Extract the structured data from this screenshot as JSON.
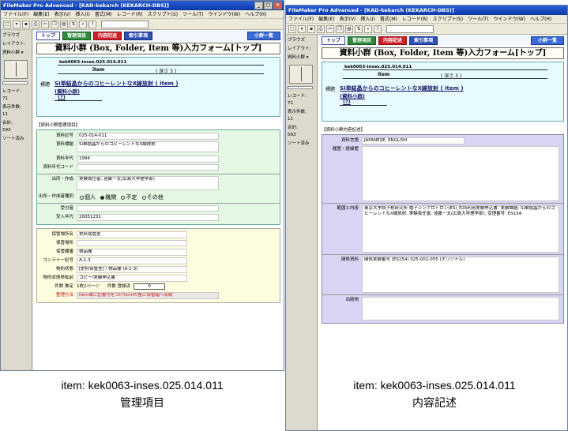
{
  "windows": [
    {
      "title": "FileMaker Pro Advanced - [KAD-kekarch (KEKARCH-DBS)]",
      "menu": [
        "ファイル(F)",
        "編集(E)",
        "表示(V)",
        "挿入(I)",
        "書式(M)",
        "レコード(R)",
        "スクリプト(S)",
        "ツール(T)",
        "ウインドウ(W)",
        "ヘルプ(H)"
      ],
      "left_panel": {
        "browse": "ブラウズ",
        "layout": "レイアウト:",
        "layout_name": "資料小群 ▾",
        "record": "レコード:",
        "record_no": "71",
        "found": "表示件数:",
        "found_no": "11",
        "total": "合計:",
        "total_no": "593",
        "sort": "ソート済み"
      },
      "nav": {
        "top": "トップ",
        "admin": "管理項目",
        "content": "内容記述",
        "index": "索引事項",
        "list": "小群一覧"
      },
      "form_title": "資料小群 (Box, Folder, Item 等)入力フォーム[トップ]",
      "item": {
        "id": "kek0063-inses.025.014.011",
        "type": "item",
        "depth": "( 深さ 3 )",
        "label": "標題",
        "title": "SI単結晶からのコヒーレントなX線放射 ( item )",
        "sub": "(資料小群)",
        "sub2": "(?)"
      },
      "section_label": "【資料小群管理項目】",
      "admin_fields": [
        {
          "label": "資料記号",
          "value": "025-014-011"
        },
        {
          "label": "資料標題",
          "value": "Si単結晶からのコヒーレントなX線放射"
        },
        {
          "label": "資料年代",
          "value": "1994"
        },
        {
          "label": "資料年代コード",
          "value": ""
        },
        {
          "label": "出所・作成",
          "value": "実験責任者: 遠藤一太(広島大学理学部)"
        }
      ],
      "origin_type": {
        "label": "出所・作成者種別",
        "options": [
          "個人",
          "機関",
          "不定",
          "その他"
        ],
        "selected": "機関"
      },
      "receipt_fields": [
        {
          "label": "受付者",
          "value": ""
        },
        {
          "label": "受入年代",
          "value": "20051231"
        }
      ],
      "storage_fields": [
        {
          "label": "保管場所名",
          "value": "史料保管室"
        },
        {
          "label": "保管場所",
          "value": ""
        },
        {
          "label": "保管棚番",
          "value": "物品棚"
        },
        {
          "label": "コンテナ一記号",
          "value": "A-1-3"
        },
        {
          "label": "物的状態",
          "value": "[史料保管室] / 物品棚 (A-1-3)"
        },
        {
          "label": "物的状態移転前",
          "value": "コピー/実験申込書"
        }
      ],
      "count_row": {
        "label": "件数 推定",
        "pages": "1枚2ページ",
        "count_label": "件数 登録済",
        "count": "0"
      },
      "method": {
        "label": "整理方法",
        "value": "item単に記番号をつけhtmlの整に保管箱へ収納"
      },
      "caption1": "item: kek0063-inses.025.014.011",
      "caption2": "管理項目"
    },
    {
      "title": "FileMaker Pro Advanced - [KAD-kekarch (KEKARCH-DBS)]",
      "menu": [
        "ファイル(F)",
        "編集(E)",
        "表示(V)",
        "挿入(I)",
        "書式(M)",
        "レコード(R)",
        "スクリプト(S)",
        "ツール(T)",
        "ウインドウ(W)",
        "ヘルプ(H)"
      ],
      "left_panel": {
        "browse": "ブラウズ",
        "layout": "レイアウト:",
        "layout_name": "資料小群 ▾",
        "record": "レコード:",
        "record_no": "71",
        "found": "表示件数:",
        "found_no": "11",
        "total": "合計:",
        "total_no": "593",
        "sort": "ソート済み"
      },
      "nav": {
        "top": "トップ",
        "admin": "管理項目",
        "content": "内容記述",
        "index": "索引事項",
        "list": "小群一覧"
      },
      "form_title": "資料小群 (Box, Folder, Item 等)入力フォーム[トップ]",
      "item": {
        "id": "kek0063-inses.025.014.011",
        "type": "item",
        "depth": "( 深さ 3 )",
        "label": "標題",
        "title": "SI単結晶からのコヒーレントなX線放射 ( item )",
        "sub": "(資料小群)",
        "sub2": "(?)"
      },
      "section_label": "【資料小群内容記述】",
      "content_fields": [
        {
          "label": "資料言語",
          "value": "JAPANESE, ENGLISH"
        },
        {
          "label": "履歴・経緯歴",
          "value": ""
        },
        {
          "label": "範囲と内容",
          "value": "東京大学原子核研究所 電子シンクロトロン(ES) 共同利用実験申込書: 実験課題: Si単結晶からのコヒーレントなX線放射, 実験責任者: 遠藤一太(広島大学理学部), 受理番号: ES154"
        },
        {
          "label": "関係資料",
          "value": "関係実験番号 (ES154) 025-002-055 (オリジナル)"
        },
        {
          "label": "出版物",
          "value": ""
        }
      ],
      "caption1": "item: kek0063-inses.025.014.011",
      "caption2": "内容記述"
    }
  ]
}
